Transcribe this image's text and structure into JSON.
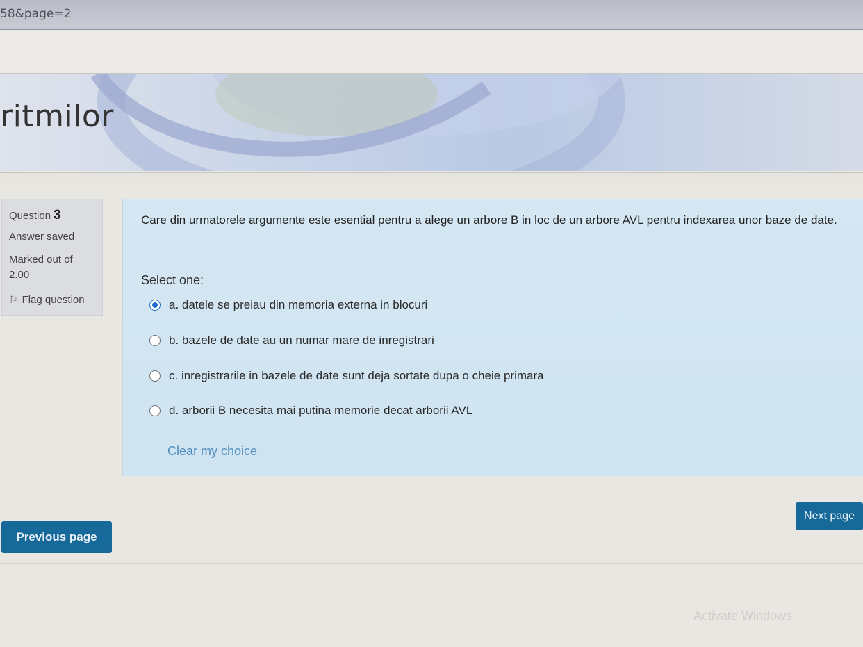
{
  "browser": {
    "url_fragment": "58&page=2"
  },
  "banner": {
    "title": "ritmilor"
  },
  "question_info": {
    "question_label": "Question",
    "question_number": "3",
    "state": "Answer saved",
    "marked_label": "Marked out of",
    "marked_value": "2.00",
    "flag_label": "Flag question"
  },
  "question": {
    "text": "Care din urmatorele argumente este esential pentru a alege un arbore B in loc de un arbore AVL pentru indexarea unor baze de date.",
    "prompt": "Select one:",
    "options": [
      {
        "label": "a. datele se preiau din memoria externa in blocuri",
        "selected": true
      },
      {
        "label": "b. bazele de date au un numar mare de inregistrari",
        "selected": false
      },
      {
        "label": "c. inregistrarile in bazele de date sunt deja sortate dupa o cheie primara",
        "selected": false
      },
      {
        "label": "d. arborii B necesita mai putina memorie decat arborii AVL",
        "selected": false
      }
    ],
    "clear_label": "Clear my choice"
  },
  "navigation": {
    "previous_label": "Previous page",
    "next_label": "Next page"
  },
  "watermark": "Activate Windows",
  "colors": {
    "accent": "#17699a",
    "question_bg": "#d5e7f3",
    "link": "#4f8fbf"
  }
}
